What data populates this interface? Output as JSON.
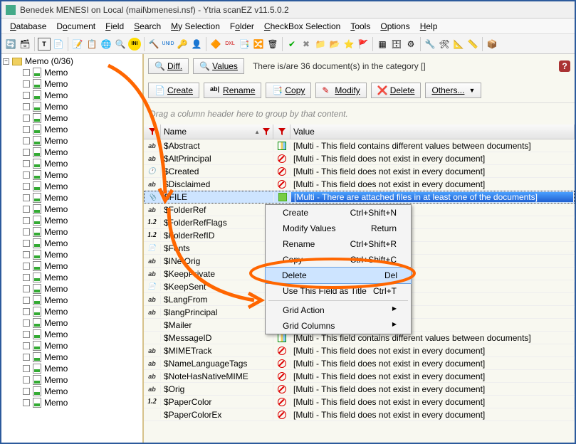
{
  "window": {
    "title": "Benedek MENESI on Local (mail\\bmenesi.nsf) - Ytria scanEZ v11.5.0.2"
  },
  "menubar": [
    {
      "label": "Database",
      "accel": "D"
    },
    {
      "label": "Document",
      "accel": "o"
    },
    {
      "label": "Field",
      "accel": "F"
    },
    {
      "label": "Search",
      "accel": "S"
    },
    {
      "label": "My Selection",
      "accel": "M"
    },
    {
      "label": "Folder",
      "accel": "o"
    },
    {
      "label": "CheckBox Selection",
      "accel": "C"
    },
    {
      "label": "Tools",
      "accel": "T"
    },
    {
      "label": "Options",
      "accel": "O"
    },
    {
      "label": "Help",
      "accel": "H"
    }
  ],
  "tree": {
    "root": "Memo  (0/36)",
    "item_label": "Memo",
    "count": 30
  },
  "actionbar": {
    "diff": "Diff.",
    "values": "Values",
    "status": "There is/are 36 document(s) in the category []",
    "create": "Create",
    "rename": "Rename",
    "copy": "Copy",
    "modify": "Modify",
    "delete": "Delete",
    "others": "Others..."
  },
  "groupbar": "Drag a column header here to group by that content.",
  "grid": {
    "cols": {
      "name": "Name",
      "value": "Value"
    },
    "val_multi": "[Multi - This field contains different values between documents]",
    "val_noexist": "[Multi - This field does not exist in every document]",
    "val_attach": "[Multi - There are attached files in at least one of the documents]",
    "rows": [
      {
        "type": "ab",
        "name": "$Abstract",
        "val": "multi"
      },
      {
        "type": "ab",
        "name": "$AltPrincipal",
        "val": "noexist"
      },
      {
        "type": "dt",
        "name": "$Created",
        "val": "noexist"
      },
      {
        "type": "ab",
        "name": "$Disclaimed",
        "val": "noexist"
      },
      {
        "type": "att",
        "name": "$FILE",
        "val": "attach",
        "selected": true
      },
      {
        "type": "ab",
        "name": "$FolderRef",
        "val": "noexist_p"
      },
      {
        "type": "num",
        "name": "$FolderRefFlags",
        "val": "noexist_p"
      },
      {
        "type": "num",
        "name": "$FolderRefID",
        "val": "noexist_p"
      },
      {
        "type": "doc",
        "name": "$Fonts",
        "val": "noexist_p"
      },
      {
        "type": "ab",
        "name": "$INetOrig",
        "val": "noexist_p"
      },
      {
        "type": "ab",
        "name": "$KeepPrivate",
        "val": "noexist_p"
      },
      {
        "type": "doc",
        "name": "$KeepSent",
        "val": "noexist_p"
      },
      {
        "type": "ab",
        "name": "$LangFrom",
        "val": "noexist_p"
      },
      {
        "type": "ab",
        "name": "$langPrincipal",
        "val": "noexist_p"
      },
      {
        "type": "",
        "name": "$Mailer",
        "val": "hidden"
      },
      {
        "type": "",
        "name": "$MessageID",
        "val": "multi"
      },
      {
        "type": "ab",
        "name": "$MIMETrack",
        "val": "noexist"
      },
      {
        "type": "ab",
        "name": "$NameLanguageTags",
        "val": "noexist"
      },
      {
        "type": "ab",
        "name": "$NoteHasNativeMIME",
        "val": "noexist"
      },
      {
        "type": "ab",
        "name": "$Orig",
        "val": "noexist"
      },
      {
        "type": "num",
        "name": "$PaperColor",
        "val": "noexist"
      },
      {
        "type": "",
        "name": "$PaperColorEx",
        "val": "noexist"
      }
    ]
  },
  "ctxmenu": {
    "create": {
      "label": "Create",
      "short": "Ctrl+Shift+N"
    },
    "modify": {
      "label": "Modify Values",
      "short": "Return"
    },
    "rename": {
      "label": "Rename",
      "short": "Ctrl+Shift+R"
    },
    "copy": {
      "label": "Copy",
      "short": "Ctrl+Shift+C"
    },
    "delete": {
      "label": "Delete",
      "short": "Del"
    },
    "usetitle": {
      "label": "Use This Field as Title",
      "short": "Ctrl+T"
    },
    "gridaction": {
      "label": "Grid Action"
    },
    "gridcols": {
      "label": "Grid Columns"
    }
  }
}
